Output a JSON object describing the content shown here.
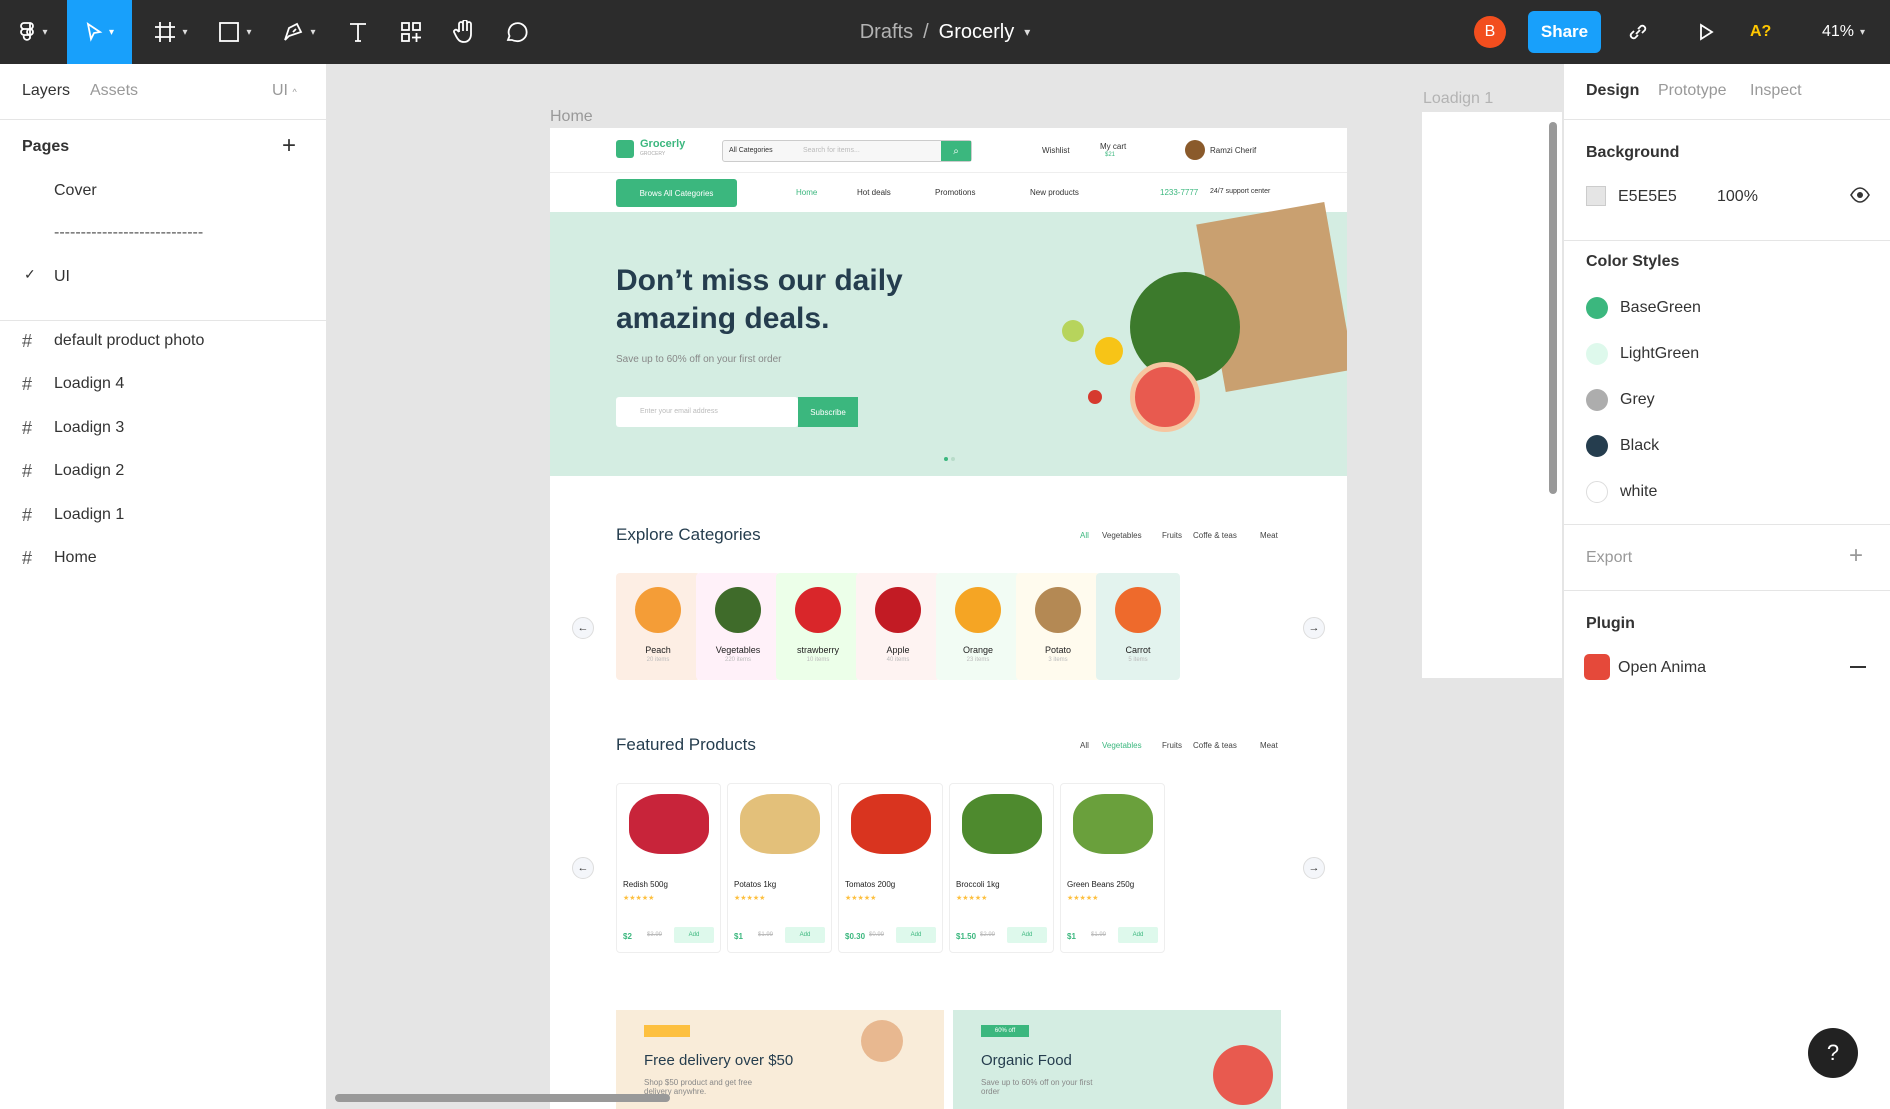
{
  "toolbar": {
    "breadcrumb_folder": "Drafts",
    "breadcrumb_sep": "/",
    "file_name": "Grocerly",
    "user_initial": "B",
    "share_label": "Share",
    "help_label": "A?",
    "zoom": "41%"
  },
  "left_panel": {
    "tab_layers": "Layers",
    "tab_assets": "Assets",
    "page_selector": "UI",
    "pages_title": "Pages",
    "pages": [
      "Cover",
      "----------------------------",
      "UI"
    ],
    "layers": [
      "default product photo",
      "Loadign 4",
      "Loadign 3",
      "Loadign 2",
      "Loadign 1",
      "Home"
    ]
  },
  "right_panel": {
    "tab_design": "Design",
    "tab_prototype": "Prototype",
    "tab_inspect": "Inspect",
    "background_title": "Background",
    "background_hex": "E5E5E5",
    "background_opacity": "100%",
    "color_styles_title": "Color Styles",
    "color_styles": [
      {
        "name": "BaseGreen",
        "color": "#3bb77e"
      },
      {
        "name": "LightGreen",
        "color": "#def9ec"
      },
      {
        "name": "Grey",
        "color": "#adadad"
      },
      {
        "name": "Black",
        "color": "#253d4e"
      },
      {
        "name": "white",
        "color": "#ffffff"
      }
    ],
    "export_title": "Export",
    "plugin_title": "Plugin",
    "plugin_name": "Open Anima"
  },
  "canvas": {
    "home_label": "Home",
    "loadign_label": "Loadign 1"
  },
  "design": {
    "brand": "Grocerly",
    "brand_sub": "GROCERY",
    "all_categories": "All Categories",
    "search_placeholder": "Search for items...",
    "wishlist": "Wishlist",
    "cart": "My cart",
    "cart_amount": "$21",
    "user": "Ramzi Cherif",
    "browse_all": "Brows All Categories",
    "nav": [
      "Home",
      "Hot deals",
      "Promotions",
      "New products"
    ],
    "support_phone": "1233-7777",
    "support_text": "24/7 support center",
    "hero_title_1": "Don’t miss our daily",
    "hero_title_2": "amazing deals.",
    "hero_sub": "Save up to 60% off on your first order",
    "email_placeholder": "Enter your email address",
    "subscribe": "Subscribe",
    "explore_title": "Explore Categories",
    "filters": [
      "All",
      "Vegetables",
      "Fruits",
      "Coffe & teas",
      "Meat"
    ],
    "categories": [
      {
        "name": "Peach",
        "count": "20 items",
        "bg": "#fdeee4",
        "fill": "#f49d37"
      },
      {
        "name": "Vegetables",
        "count": "220 items",
        "bg": "#fff1f9",
        "fill": "#3f6b2a"
      },
      {
        "name": "strawberry",
        "count": "10 items",
        "bg": "#ecffe9",
        "fill": "#d9262a"
      },
      {
        "name": "Apple",
        "count": "40 items",
        "bg": "#fef3f2",
        "fill": "#c21b24"
      },
      {
        "name": "Orange",
        "count": "23 items",
        "bg": "#f2fcf4",
        "fill": "#f5a524"
      },
      {
        "name": "Potato",
        "count": "3 items",
        "bg": "#fffbee",
        "fill": "#b48954"
      },
      {
        "name": "Carrot",
        "count": "5 items",
        "bg": "#e3f3ee",
        "fill": "#ee6a2c"
      }
    ],
    "featured_title": "Featured Products",
    "products": [
      {
        "name": "Redish 500g",
        "price": "$2",
        "old": "$3.99",
        "fill": "#c8243a"
      },
      {
        "name": "Potatos 1kg",
        "price": "$1",
        "old": "$1.99",
        "fill": "#e3c07a"
      },
      {
        "name": "Tomatos 200g",
        "price": "$0.30",
        "old": "$0.99",
        "fill": "#d9341f"
      },
      {
        "name": "Broccoli 1kg",
        "price": "$1.50",
        "old": "$2.99",
        "fill": "#4e8a2e"
      },
      {
        "name": "Green Beans 250g",
        "price": "$1",
        "old": "$1.99",
        "fill": "#6aa03c"
      }
    ],
    "add_label": "Add",
    "promo1_title": "Free delivery over $50",
    "promo1_sub": "Shop $50 product and get free delivery anywhre.",
    "promo2_badge": "60% off",
    "promo2_title": "Organic Food",
    "promo2_sub": "Save up to 60% off on your first order"
  }
}
